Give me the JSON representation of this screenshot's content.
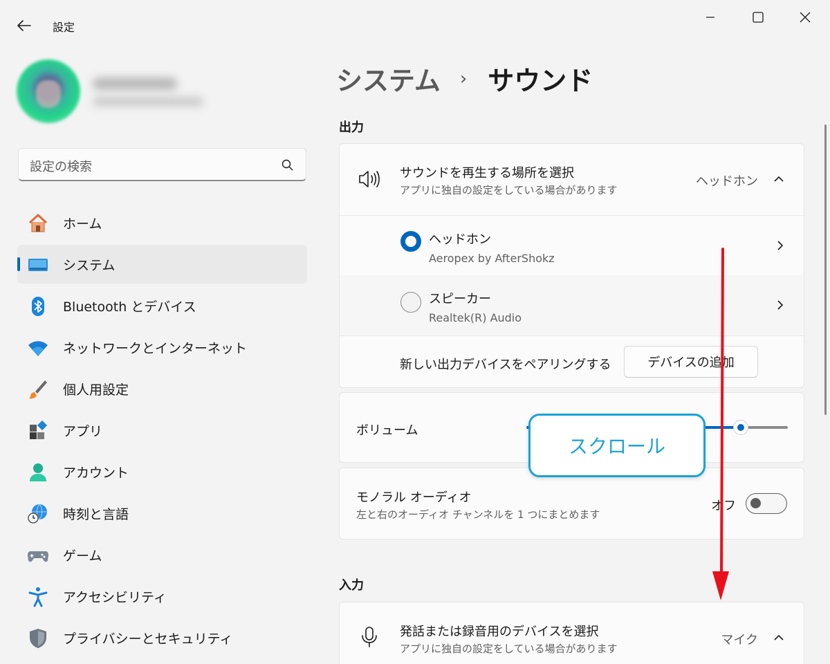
{
  "window": {
    "title": "設定",
    "controls": [
      "minimize-icon",
      "maximize-icon",
      "close-icon"
    ]
  },
  "search": {
    "placeholder": "設定の検索"
  },
  "nav": {
    "items": [
      {
        "label": "ホーム",
        "icon": "home-icon"
      },
      {
        "label": "システム",
        "icon": "system-icon",
        "active": true
      },
      {
        "label": "Bluetooth とデバイス",
        "icon": "bluetooth-icon"
      },
      {
        "label": "ネットワークとインターネット",
        "icon": "wifi-icon"
      },
      {
        "label": "個人用設定",
        "icon": "brush-icon"
      },
      {
        "label": "アプリ",
        "icon": "apps-icon"
      },
      {
        "label": "アカウント",
        "icon": "account-icon"
      },
      {
        "label": "時刻と言語",
        "icon": "globe-clock-icon"
      },
      {
        "label": "ゲーム",
        "icon": "gamepad-icon"
      },
      {
        "label": "アクセシビリティ",
        "icon": "accessibility-icon"
      },
      {
        "label": "プライバシーとセキュリティ",
        "icon": "shield-icon"
      }
    ]
  },
  "header": {
    "parent": "システム",
    "separator": "›",
    "current": "サウンド"
  },
  "output": {
    "section_title": "出力",
    "select": {
      "title": "サウンドを再生する場所を選択",
      "subtitle": "アプリに独自の設定をしている場合があります",
      "value": "ヘッドホン"
    },
    "devices": [
      {
        "name": "ヘッドホン",
        "detail": "Aeropex by AfterShokz",
        "selected": true
      },
      {
        "name": "スピーカー",
        "detail": "Realtek(R) Audio",
        "selected": false
      }
    ],
    "pair_label": "新しい出力デバイスをペアリングする",
    "add_device_button": "デバイスの追加",
    "volume_label": "ボリューム",
    "mono": {
      "title": "モノラル オーディオ",
      "subtitle": "左と右のオーディオ チャンネルを 1 つにまとめます",
      "state": "オフ"
    }
  },
  "input": {
    "section_title": "入力",
    "select": {
      "title": "発話または録音用のデバイスを選択",
      "subtitle": "アプリに独自の設定をしている場合があります",
      "value": "マイク"
    }
  },
  "annotation": {
    "label": "スクロール",
    "color": "#1aa3d6",
    "arrow_color": "#e8101a"
  },
  "colors": {
    "accent": "#0067c0",
    "background": "#f3f3f3",
    "card": "#fbfbfb"
  }
}
